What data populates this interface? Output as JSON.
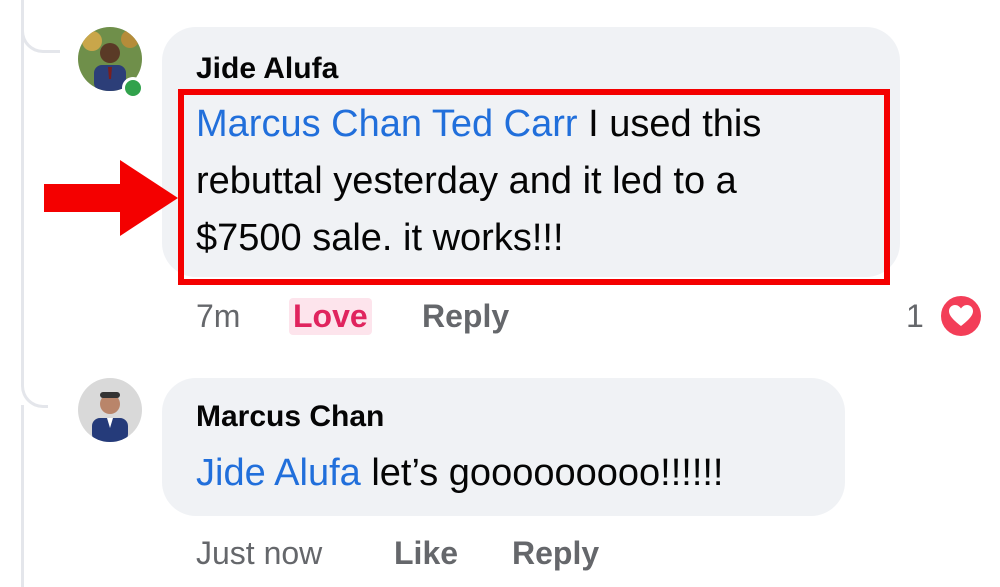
{
  "comment_1": {
    "author": "Jide Alufa",
    "mentions": [
      "Marcus Chan",
      "Ted Carr"
    ],
    "line_1_text": " I used this",
    "line_2_text": "rebuttal yesterday and it led to a",
    "line_3_text": "$7500 sale. it works!!!",
    "timestamp": "7m",
    "love_label": "Love",
    "reply_label": "Reply",
    "reaction_count": "1",
    "reaction_icon": "heart-icon",
    "author_online": true
  },
  "comment_2": {
    "author": "Marcus Chan",
    "mention": "Jide Alufa",
    "text": " let’s gooooooooo!!!!!!",
    "timestamp": "Just now",
    "like_label": "Like",
    "reply_label": "Reply"
  },
  "annotation": {
    "highlight_color": "#f40000",
    "arrow_color": "#f40000"
  },
  "colors": {
    "mention": "#216fdb",
    "love": "#e0245e",
    "online": "#31a24c",
    "bubble": "#f0f2f5",
    "secondary_text": "#65676b"
  }
}
